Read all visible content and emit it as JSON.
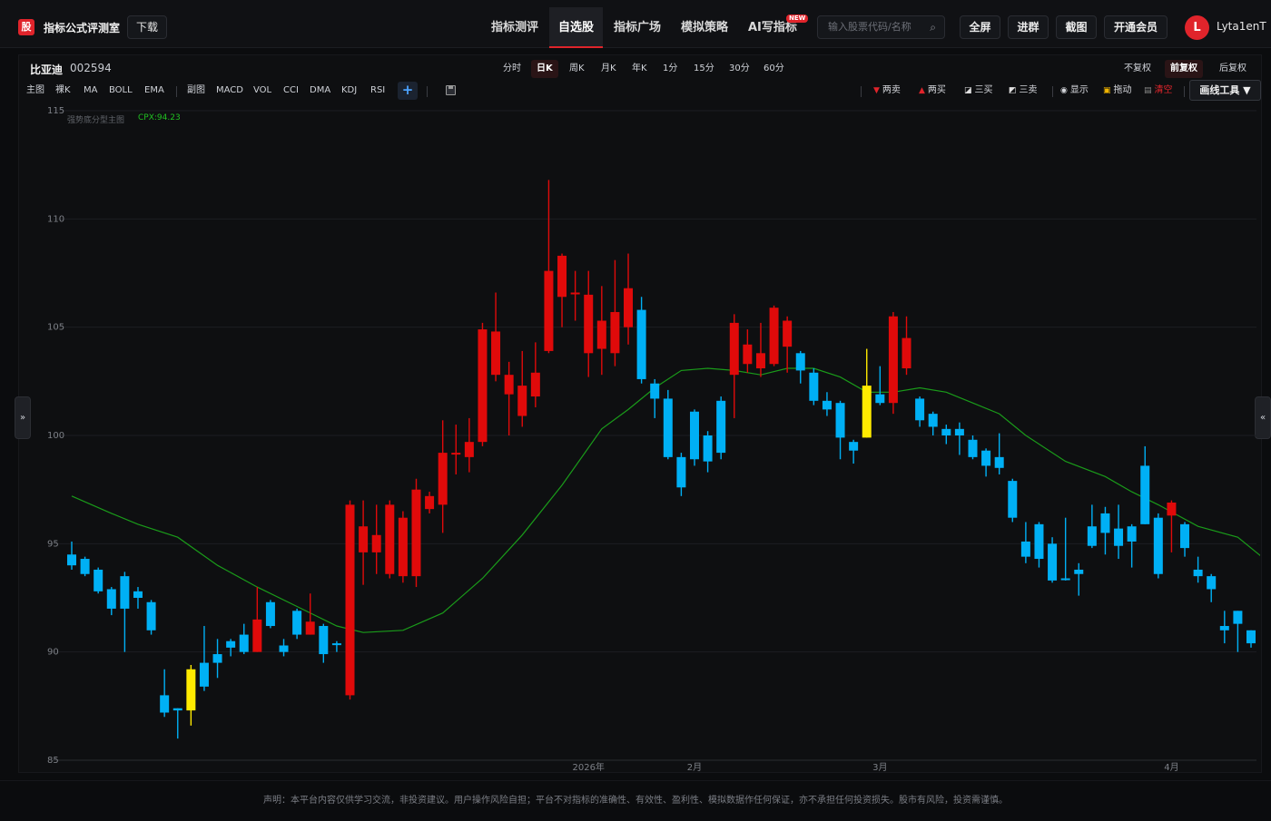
{
  "app": {
    "logo_char": "股",
    "name": "指标公式评测室",
    "download_label": "下载"
  },
  "nav": {
    "items": [
      "指标测评",
      "自选股",
      "指标广场",
      "模拟策略",
      "AI写指标"
    ],
    "active_index": 1,
    "new_badge": "NEW"
  },
  "search": {
    "placeholder": "输入股票代码/名称"
  },
  "top_actions": {
    "fullscreen": "全屏",
    "join_group": "进群",
    "screenshot": "截图",
    "membership": "开通会员"
  },
  "user": {
    "avatar_letter": "L",
    "name": "Lyta1enT"
  },
  "stock": {
    "name": "比亚迪",
    "code": "002594"
  },
  "periods": {
    "items": [
      "分时",
      "日K",
      "周K",
      "月K",
      "年K",
      "1分",
      "15分",
      "30分",
      "60分"
    ],
    "active_index": 1
  },
  "adjust": {
    "items": [
      "不复权",
      "前复权",
      "后复权"
    ],
    "active_index": 1
  },
  "indicators": {
    "main_label": "主图",
    "main_items": [
      "裸K",
      "MA",
      "BOLL",
      "EMA"
    ],
    "sub_label": "副图",
    "sub_items": [
      "MACD",
      "VOL",
      "CCI",
      "DMA",
      "KDJ",
      "RSI"
    ],
    "add": "+"
  },
  "tools": {
    "two_sell": "两卖",
    "two_buy": "两买",
    "three_buy": "三买",
    "three_sell": "三卖",
    "show": "显示",
    "drag": "拖动",
    "clear": "清空",
    "draw_tool": "画线工具 ▼"
  },
  "side_tabs": {
    "left": "»",
    "right": "«"
  },
  "legend": {
    "label": "强势底分型主图",
    "value": "CPX:94.23"
  },
  "footer": {
    "text": "声明：本平台内容仅供学习交流，非投资建议。用户操作风险自担；平台不对指标的准确性、有效性、盈利性、模拟数据作任何保证，亦不承担任何投资损失。股市有风险，投资需谨慎。"
  },
  "colors": {
    "up": "#e00a0a",
    "down": "#00b0f5",
    "signal": "#ffeb00",
    "ma": "#1a9b1a",
    "accent": "#e0242b"
  },
  "chart_data": {
    "type": "candlestick",
    "ylim": [
      85,
      115
    ],
    "yticks": [
      85,
      90,
      95,
      100,
      105,
      110,
      115
    ],
    "xtick_labels": [
      "2026年",
      "2月",
      "3月",
      "4月"
    ],
    "xtick_index": [
      39,
      47,
      61,
      83
    ],
    "candles": [
      [
        94.5,
        94.0,
        95.1,
        93.8,
        "d"
      ],
      [
        94.3,
        93.6,
        94.4,
        93.5,
        "d"
      ],
      [
        93.8,
        92.8,
        93.9,
        92.7,
        "d"
      ],
      [
        92.9,
        92.0,
        93.0,
        91.7,
        "d"
      ],
      [
        93.5,
        92.0,
        93.7,
        90.0,
        "d"
      ],
      [
        92.8,
        92.5,
        93.0,
        92.0,
        "d"
      ],
      [
        92.3,
        91.0,
        92.4,
        90.8,
        "d"
      ],
      [
        88.0,
        87.2,
        89.2,
        87.0,
        "d"
      ],
      [
        87.4,
        87.3,
        87.4,
        86.0,
        "d"
      ],
      [
        87.3,
        89.2,
        89.4,
        86.6,
        "s"
      ],
      [
        89.5,
        88.4,
        91.2,
        88.2,
        "d"
      ],
      [
        89.9,
        89.5,
        90.6,
        88.8,
        "d"
      ],
      [
        90.5,
        90.2,
        90.6,
        89.8,
        "d"
      ],
      [
        90.8,
        90.0,
        91.3,
        89.9,
        "d"
      ],
      [
        90.0,
        91.5,
        93.0,
        90.0,
        "u"
      ],
      [
        92.3,
        91.2,
        92.4,
        91.1,
        "d"
      ],
      [
        90.3,
        90.0,
        90.6,
        89.8,
        "d"
      ],
      [
        91.9,
        90.8,
        92.0,
        90.6,
        "d"
      ],
      [
        90.8,
        91.4,
        92.7,
        90.8,
        "u"
      ],
      [
        91.2,
        89.9,
        91.3,
        89.5,
        "d"
      ],
      [
        90.4,
        90.4,
        90.5,
        90.0,
        "d"
      ],
      [
        88.0,
        96.8,
        97.0,
        87.8,
        "u"
      ],
      [
        94.6,
        95.8,
        97.0,
        93.1,
        "u"
      ],
      [
        94.6,
        95.4,
        96.8,
        93.6,
        "u"
      ],
      [
        93.6,
        96.8,
        97.0,
        93.4,
        "u"
      ],
      [
        93.5,
        96.2,
        96.5,
        93.2,
        "u"
      ],
      [
        93.5,
        97.5,
        98.0,
        93.0,
        "u"
      ],
      [
        96.6,
        97.2,
        97.4,
        96.4,
        "u"
      ],
      [
        96.8,
        99.2,
        100.7,
        95.5,
        "u"
      ],
      [
        99.2,
        99.2,
        100.5,
        98.2,
        "u"
      ],
      [
        99.0,
        99.7,
        100.8,
        98.3,
        "u"
      ],
      [
        99.7,
        104.9,
        105.2,
        99.5,
        "u"
      ],
      [
        102.8,
        104.8,
        106.6,
        102.5,
        "u"
      ],
      [
        101.9,
        102.8,
        103.4,
        100.0,
        "u"
      ],
      [
        100.9,
        102.3,
        103.9,
        100.4,
        "u"
      ],
      [
        101.8,
        102.9,
        104.3,
        101.3,
        "u"
      ],
      [
        103.9,
        107.6,
        111.8,
        103.8,
        "u"
      ],
      [
        106.4,
        108.3,
        108.4,
        105.0,
        "u"
      ],
      [
        106.6,
        106.6,
        107.6,
        105.3,
        "u"
      ],
      [
        103.8,
        106.5,
        107.6,
        102.7,
        "u"
      ],
      [
        104.0,
        105.3,
        106.9,
        102.8,
        "u"
      ],
      [
        103.8,
        105.7,
        108.1,
        103.2,
        "u"
      ],
      [
        105.0,
        106.8,
        108.4,
        104.2,
        "u"
      ],
      [
        105.8,
        102.6,
        106.4,
        102.4,
        "d"
      ],
      [
        102.4,
        101.7,
        102.6,
        100.8,
        "d"
      ],
      [
        101.7,
        99.0,
        102.1,
        98.9,
        "d"
      ],
      [
        99.0,
        97.6,
        99.2,
        97.2,
        "d"
      ],
      [
        101.1,
        98.9,
        101.2,
        98.6,
        "d"
      ],
      [
        100.0,
        98.8,
        100.2,
        98.3,
        "d"
      ],
      [
        101.6,
        99.2,
        101.8,
        98.9,
        "d"
      ],
      [
        102.8,
        105.2,
        105.6,
        100.8,
        "u"
      ],
      [
        103.3,
        104.2,
        104.9,
        102.9,
        "u"
      ],
      [
        103.1,
        103.8,
        105.2,
        102.7,
        "u"
      ],
      [
        103.3,
        105.9,
        106.0,
        103.2,
        "u"
      ],
      [
        104.1,
        105.3,
        105.5,
        102.9,
        "u"
      ],
      [
        103.8,
        103.0,
        103.9,
        102.4,
        "d"
      ],
      [
        102.9,
        101.6,
        103.1,
        101.4,
        "d"
      ],
      [
        101.6,
        101.2,
        102.0,
        100.9,
        "d"
      ],
      [
        101.5,
        99.9,
        101.6,
        98.9,
        "d"
      ],
      [
        99.7,
        99.3,
        99.8,
        98.7,
        "d"
      ],
      [
        99.9,
        102.3,
        104.0,
        99.9,
        "s"
      ],
      [
        101.9,
        101.5,
        103.2,
        101.4,
        "d"
      ],
      [
        101.5,
        105.5,
        105.7,
        101.0,
        "u"
      ],
      [
        103.1,
        104.5,
        105.5,
        102.8,
        "u"
      ],
      [
        101.7,
        100.7,
        101.8,
        100.4,
        "d"
      ],
      [
        101.0,
        100.4,
        101.1,
        100.0,
        "d"
      ],
      [
        100.3,
        100.0,
        100.5,
        99.6,
        "d"
      ],
      [
        100.3,
        100.0,
        100.6,
        99.1,
        "d"
      ],
      [
        99.8,
        99.0,
        100.0,
        98.9,
        "d"
      ],
      [
        99.3,
        98.6,
        99.4,
        98.1,
        "d"
      ],
      [
        99.0,
        98.5,
        100.1,
        98.2,
        "d"
      ],
      [
        97.9,
        96.2,
        98.0,
        96.0,
        "d"
      ],
      [
        95.1,
        94.4,
        96.0,
        94.1,
        "d"
      ],
      [
        95.9,
        94.3,
        96.0,
        93.9,
        "d"
      ],
      [
        95.0,
        93.3,
        95.3,
        93.2,
        "d"
      ],
      [
        93.4,
        93.4,
        96.2,
        93.3,
        "d"
      ],
      [
        93.8,
        93.6,
        94.1,
        92.6,
        "d"
      ],
      [
        95.8,
        94.9,
        96.8,
        94.8,
        "d"
      ],
      [
        96.4,
        95.5,
        96.7,
        94.5,
        "d"
      ],
      [
        95.7,
        94.9,
        96.8,
        94.3,
        "d"
      ],
      [
        95.8,
        95.1,
        95.9,
        93.9,
        "d"
      ],
      [
        98.6,
        95.9,
        99.5,
        95.9,
        "d"
      ],
      [
        96.2,
        93.6,
        96.4,
        93.4,
        "d"
      ],
      [
        96.3,
        96.9,
        97.0,
        94.6,
        "u"
      ],
      [
        95.9,
        94.8,
        96.0,
        94.4,
        "d"
      ],
      [
        93.8,
        93.5,
        94.4,
        93.2,
        "d"
      ],
      [
        93.5,
        92.9,
        93.6,
        92.3,
        "d"
      ],
      [
        91.2,
        91.0,
        91.9,
        90.4,
        "d"
      ],
      [
        91.9,
        91.3,
        91.9,
        90.0,
        "d"
      ],
      [
        91.0,
        90.4,
        91.0,
        90.2,
        "d"
      ]
    ],
    "ma": {
      "name": "",
      "x": [
        0,
        3,
        5,
        8,
        11,
        14,
        17,
        20,
        22,
        25,
        28,
        31,
        34,
        37,
        40,
        42,
        44,
        46,
        48,
        50,
        52,
        54,
        56,
        58,
        60,
        62,
        64,
        66,
        68,
        70,
        72,
        75,
        78,
        80,
        82,
        85,
        88,
        90
      ],
      "values": [
        97.2,
        96.4,
        95.9,
        95.3,
        94.0,
        93.0,
        92.1,
        91.2,
        90.9,
        91.0,
        91.8,
        93.4,
        95.4,
        97.7,
        100.3,
        101.2,
        102.2,
        103.0,
        103.1,
        103.0,
        102.8,
        103.1,
        103.1,
        102.7,
        102.0,
        102.0,
        102.2,
        102.0,
        101.5,
        101.0,
        100.0,
        98.8,
        98.1,
        97.4,
        96.8,
        95.8,
        95.3,
        94.3
      ]
    }
  }
}
